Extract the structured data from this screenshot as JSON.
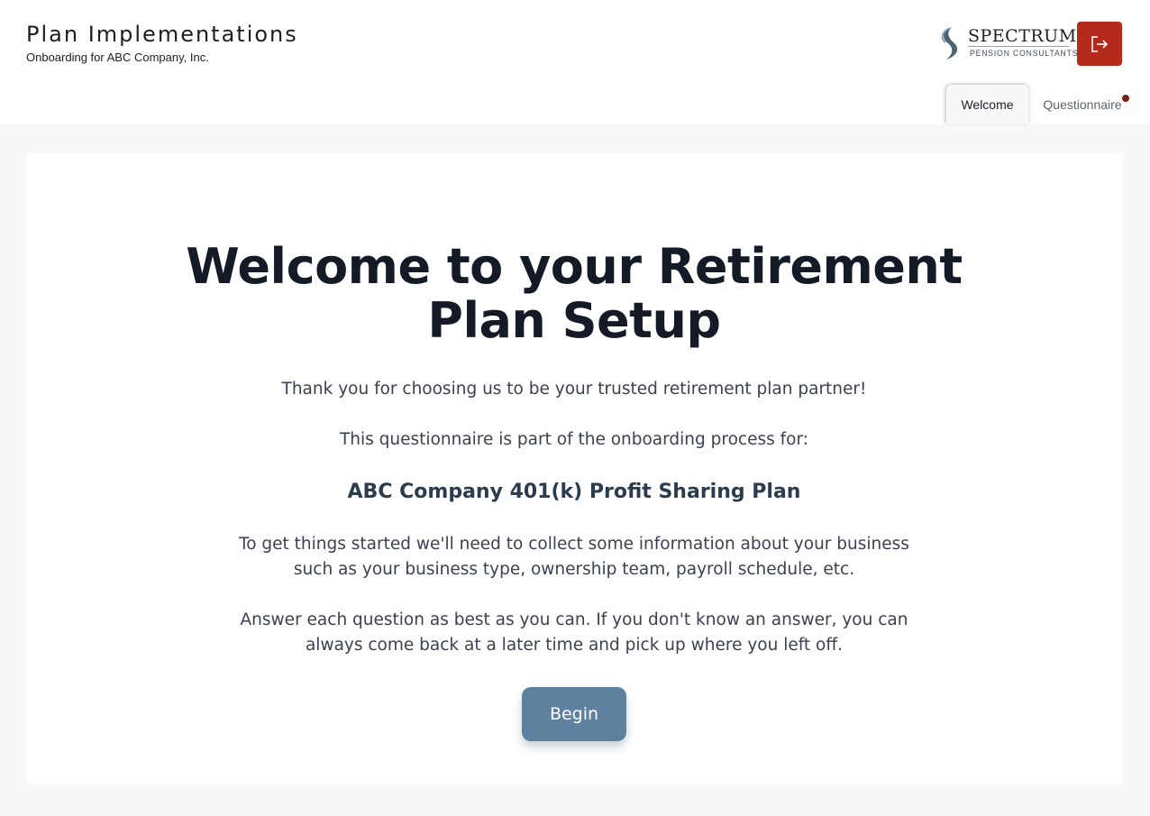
{
  "header": {
    "title": "Plan Implementations",
    "subtitle": "Onboarding for ABC Company, Inc.",
    "logo": {
      "name": "SPECTRUM",
      "tagline": "PENSION CONSULTANTS"
    },
    "logout_icon": "logout-icon"
  },
  "tabs": [
    {
      "label": "Welcome",
      "active": true
    },
    {
      "label": "Questionnaire",
      "active": false,
      "has_notification_dot": true
    }
  ],
  "main": {
    "heading_line1": "Welcome to your Retirement",
    "heading_line2": "Plan Setup",
    "thanks": "Thank you for choosing us to be your trusted retirement plan partner!",
    "intro": "This questionnaire is part of the onboarding process for:",
    "plan_name": "ABC Company 401(k) Profit Sharing Plan",
    "collect_line1": "To get things started we'll need to collect some information about your business",
    "collect_line2": "such as your business type, ownership team, payroll schedule, etc.",
    "answer_line1": "Answer each question as best as you can. If you don't know an answer, you can",
    "answer_line2": "always come back at a later time and pick up where you left off.",
    "begin_label": "Begin"
  },
  "colors": {
    "logout_button": "#b52b1b",
    "begin_button": "#5f81a0",
    "notification_dot": "#7a1f14",
    "plan_name": "#2b3c4f"
  }
}
